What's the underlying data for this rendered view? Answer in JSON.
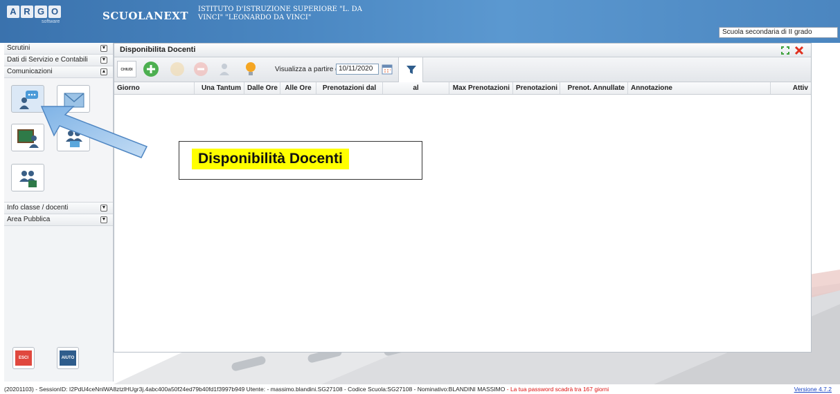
{
  "header": {
    "logo_letters": [
      "A",
      "R",
      "G",
      "O"
    ],
    "logo_sub": "software",
    "app_title": "SCUOLANEXT",
    "school_name": "ISTITUTO D'ISTRUZIONE SUPERIORE \"L. DA VINCI\" \"LEONARDO DA VINCI\"",
    "school_select": "Scuola secondaria di II grado"
  },
  "sidebar": {
    "sections": [
      {
        "label": "Scrutini"
      },
      {
        "label": "Dati di Servizio e Contabili"
      },
      {
        "label": "Comunicazioni"
      }
    ],
    "lower_sections": [
      {
        "label": "Info classe / docenti"
      },
      {
        "label": "Area Pubblica"
      }
    ],
    "bottom": {
      "esci": "ESCI",
      "aiuto": "AIUTO"
    }
  },
  "panel": {
    "title": "Disponibilita Docenti",
    "toolbar": {
      "chiudi": "CHIUDI",
      "date_label": "Visualizza a partire dal:",
      "date_value": "10/11/2020"
    },
    "columns": [
      "Giorno",
      "Una Tantum",
      "Dalle Ore",
      "Alle Ore",
      "Prenotazioni dal",
      "al",
      "Max Prenotazioni",
      "Prenotazioni",
      "Prenot. Annullate",
      "Annotazione",
      "Attiv"
    ]
  },
  "callout": {
    "text": "Disponibilità Docenti"
  },
  "status": {
    "info": "(20201103) - SessionID: I2PdU4ceNnlWA8ztzlHUgr3j.4abc400a50f24ed79b40fd1f3997b949 Utente: - massimo.blandini.SG27108 - Codice Scuola:SG27108 - Nominativo:BLANDINI MASSIMO",
    "warning": "- La tua password scadrà tra 167 giorni",
    "version": "Versione 4.7.2"
  },
  "colors": {
    "header": "#4a87c2",
    "accent_yellow": "#ffff00",
    "warn": "#dd1111",
    "link": "#1a44c4"
  }
}
